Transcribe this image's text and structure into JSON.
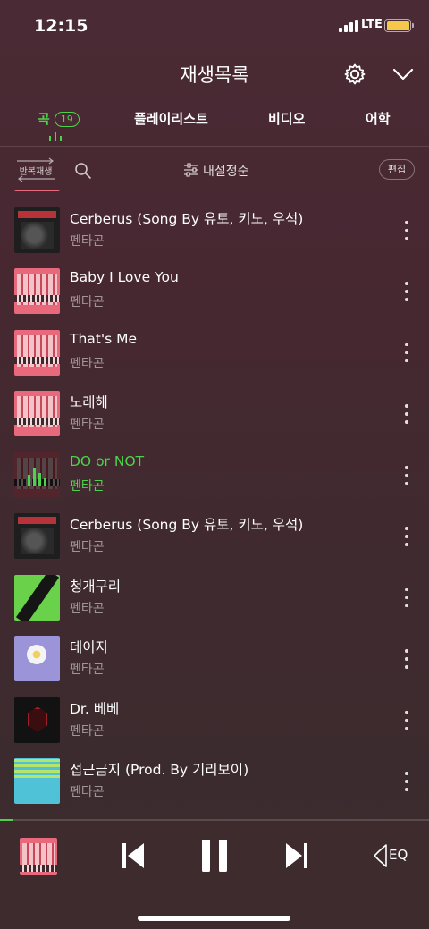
{
  "status_bar": {
    "time": "12:15",
    "network": "LTE",
    "battery_color": "#f5c84a"
  },
  "header": {
    "title": "재생목록",
    "settings_icon": "gear-icon",
    "collapse_icon": "chevron-down-icon"
  },
  "tabs": [
    {
      "label": "곡",
      "badge": "19",
      "active": true
    },
    {
      "label": "플레이리스트",
      "active": false
    },
    {
      "label": "비디오",
      "active": false
    },
    {
      "label": "어학",
      "active": false
    }
  ],
  "toolbar": {
    "repeat_label": "반복재생",
    "sort_label": "내설정순",
    "edit_label": "편집"
  },
  "tracks": [
    {
      "title": "",
      "artist": "펜타곤",
      "art": "pink",
      "playing": false
    },
    {
      "title": "Cerberus (Song By 유토, 키노, 우석)",
      "artist": "펜타곤",
      "art": "dark",
      "playing": false
    },
    {
      "title": "Baby I Love You",
      "artist": "펜타곤",
      "art": "pink",
      "playing": false
    },
    {
      "title": "That's Me",
      "artist": "펜타곤",
      "art": "pink",
      "playing": false
    },
    {
      "title": "노래해",
      "artist": "펜타곤",
      "art": "pink",
      "playing": false
    },
    {
      "title": "DO or NOT",
      "artist": "펜타곤",
      "art": "pink",
      "playing": true
    },
    {
      "title": "Cerberus (Song By 유토, 키노, 우석)",
      "artist": "펜타곤",
      "art": "dark",
      "playing": false
    },
    {
      "title": "청개구리",
      "artist": "펜타곤",
      "art": "green",
      "playing": false
    },
    {
      "title": "데이지",
      "artist": "펜타곤",
      "art": "purple",
      "playing": false
    },
    {
      "title": "Dr. 베베",
      "artist": "펜타곤",
      "art": "black",
      "playing": false
    },
    {
      "title": "접근금지 (Prod. By 기리보이)",
      "artist": "펜타곤",
      "art": "teal",
      "playing": false
    }
  ],
  "player": {
    "progress": 0.03,
    "eq_label": "EQ",
    "accent_color": "#4fd24b"
  }
}
